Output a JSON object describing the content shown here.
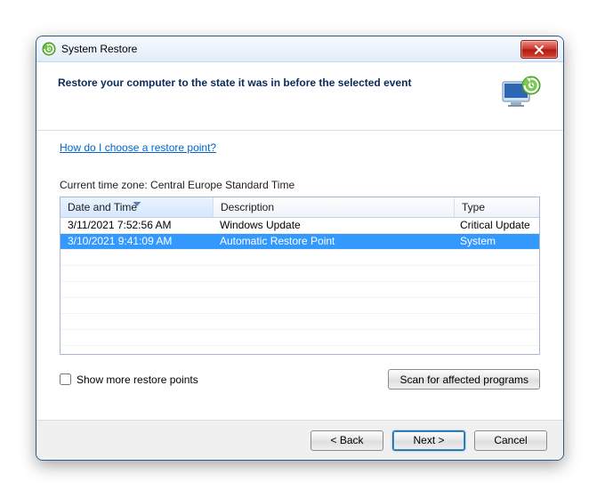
{
  "window": {
    "title": "System Restore"
  },
  "header": {
    "heading": "Restore your computer to the state it was in before the selected event"
  },
  "help": {
    "link_text": "How do I choose a restore point?"
  },
  "timezone": {
    "label": "Current time zone: Central Europe Standard Time"
  },
  "grid": {
    "columns": {
      "date": "Date and Time",
      "desc": "Description",
      "type": "Type"
    },
    "sort_column": "date",
    "rows": [
      {
        "date": "3/11/2021 7:52:56 AM",
        "desc": "Windows Update",
        "type": "Critical Update",
        "selected": false
      },
      {
        "date": "3/10/2021 9:41:09 AM",
        "desc": "Automatic Restore Point",
        "type": "System",
        "selected": true
      }
    ]
  },
  "below": {
    "show_more_label": "Show more restore points",
    "show_more_checked": false,
    "scan_button": "Scan for affected programs"
  },
  "footer": {
    "back": "< Back",
    "next": "Next >",
    "cancel": "Cancel"
  }
}
